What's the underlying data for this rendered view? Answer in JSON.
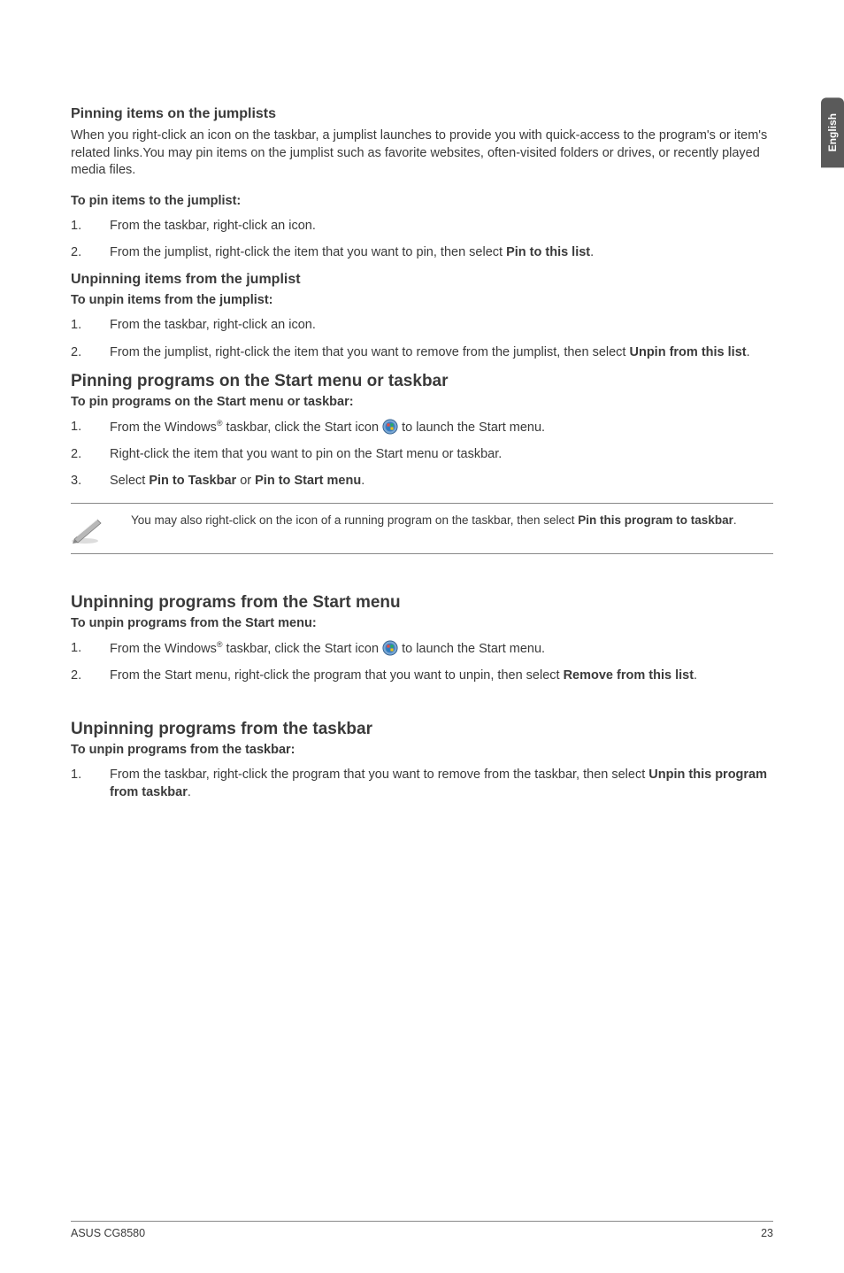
{
  "language_tab": "English",
  "sec1": {
    "heading": "Pinning items on the jumplists",
    "intro": "When you right-click an icon on the taskbar, a jumplist launches to provide you with quick-access to the program's or item's related links.You may pin items on the jumplist such as favorite websites, often-visited folders or drives, or recently played media files.",
    "lead": "To pin items to the jumplist:",
    "steps": [
      {
        "n": "1.",
        "pre": "From the taskbar, right-click an icon."
      },
      {
        "n": "2.",
        "pre": "From the jumplist, right-click the item that you want to pin, then select ",
        "bold": "Pin to this list",
        "post": "."
      }
    ]
  },
  "sec2": {
    "heading": "Unpinning items from the jumplist",
    "lead": "To unpin items from the jumplist:",
    "steps": [
      {
        "n": "1.",
        "pre": "From the taskbar, right-click an icon."
      },
      {
        "n": "2.",
        "pre": "From the jumplist, right-click the item that you want to remove from the jumplist, then select ",
        "bold": "Unpin from this list",
        "post": "."
      }
    ]
  },
  "sec3": {
    "heading": "Pinning programs on the Start menu or taskbar",
    "lead": "To pin programs on the Start menu or taskbar:",
    "step1": {
      "n": "1.",
      "pre": "From the Windows",
      "post": " taskbar, click the Start icon ",
      "tail": " to launch the Start menu."
    },
    "step2": {
      "n": "2.",
      "pre": "Right-click the item that you want to pin on the Start menu or taskbar."
    },
    "step3": {
      "n": "3.",
      "pre": "Select ",
      "b1": "Pin to Taskbar",
      "mid": " or ",
      "b2": "Pin to Start menu",
      "post": "."
    },
    "note": {
      "pre": "You may also right-click on the icon of a running program on the taskbar, then select ",
      "bold": "Pin this program to taskbar",
      "post": "."
    }
  },
  "sec4": {
    "heading": "Unpinning programs from the Start menu",
    "lead": "To unpin programs from the Start menu:",
    "step1": {
      "n": "1.",
      "pre": "From the Windows",
      "post": " taskbar, click the Start icon ",
      "tail": " to launch the Start menu."
    },
    "step2": {
      "n": "2.",
      "pre": "From the Start menu, right-click the program that you want to unpin, then select ",
      "bold": "Remove from this list",
      "post": "."
    }
  },
  "sec5": {
    "heading": "Unpinning programs from the taskbar",
    "lead": "To unpin programs from the taskbar:",
    "step1": {
      "n": "1.",
      "pre": "From the taskbar, right-click the program that you want to remove from the taskbar, then select ",
      "bold": "Unpin this program from taskbar",
      "post": "."
    }
  },
  "footer": {
    "left": "ASUS CG8580",
    "right": "23"
  },
  "sup": "®"
}
